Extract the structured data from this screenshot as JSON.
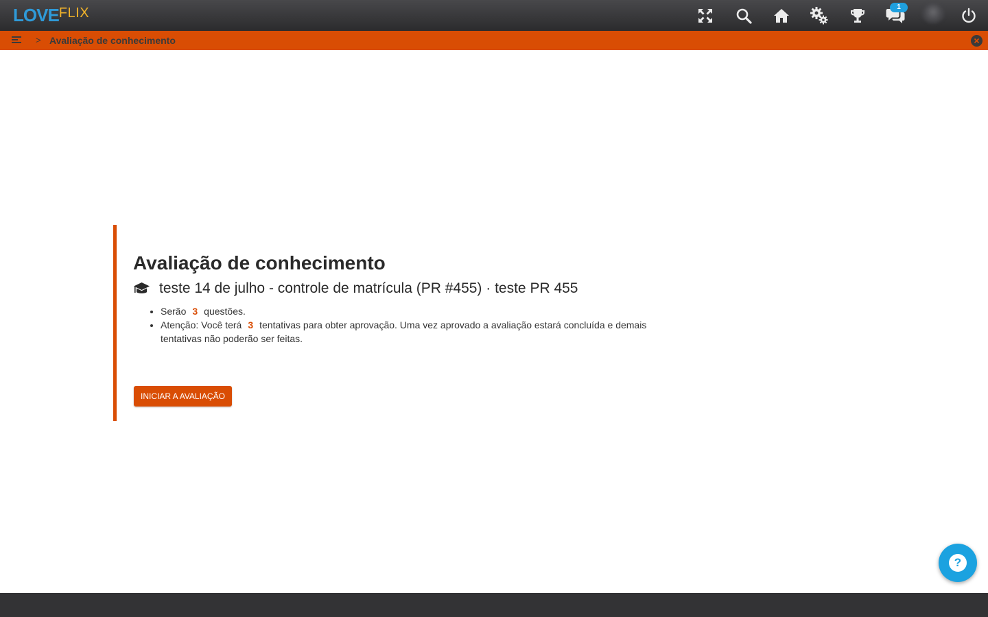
{
  "header": {
    "logo_primary": "LOVE",
    "logo_secondary": "FLIX",
    "nav_icons": [
      "fullscreen-icon",
      "search-icon",
      "home-icon",
      "settings-icon",
      "trophy-icon",
      "chat-icon",
      "avatar",
      "power-icon"
    ],
    "chat_badge": "1"
  },
  "breadcrumb": {
    "separator": ">",
    "current": "Avaliação de conhecimento"
  },
  "assessment": {
    "title": "Avaliação de conhecimento",
    "course": "teste 14 de julho - controle de matrícula (PR #455) · teste PR 455",
    "questions_prefix": "Serão",
    "questions_count": "3",
    "questions_suffix": "questões.",
    "attempts_prefix": "Atenção: Você terá",
    "attempts_count": "3",
    "attempts_suffix": "tentativas para obter aprovação. Uma vez aprovado a avaliação estará concluída e demais tentativas não poderão ser feitas.",
    "start_button": "INICIAR A AVALIAÇÃO"
  },
  "help": {
    "label": "?"
  },
  "colors": {
    "accent": "#d94d04",
    "help": "#1ba2e0",
    "topbar": "#3a3a3c"
  }
}
